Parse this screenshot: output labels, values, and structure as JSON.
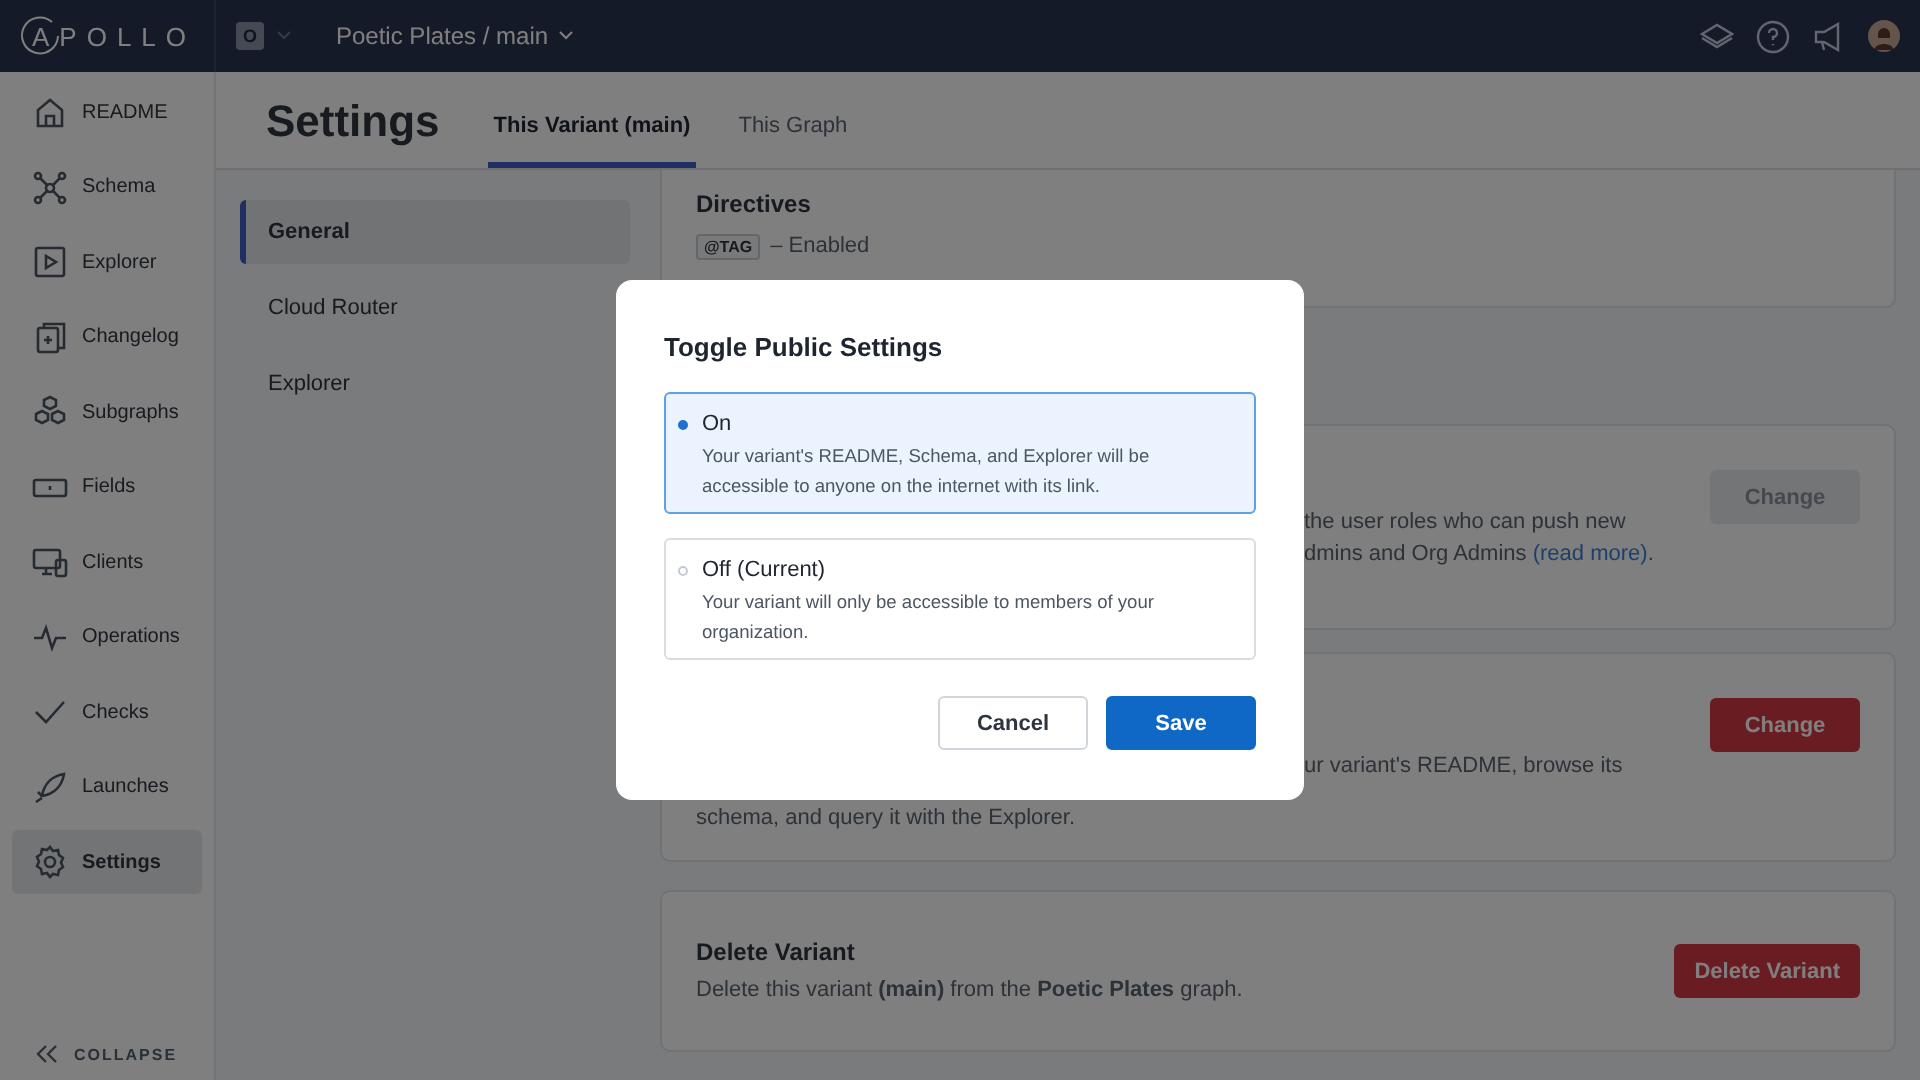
{
  "topbar": {
    "logo": "APOLLO",
    "org_badge": "O",
    "project": "Poetic Plates / main"
  },
  "sidebar": {
    "items": [
      {
        "label": "README",
        "selected": false
      },
      {
        "label": "Schema",
        "selected": false
      },
      {
        "label": "Explorer",
        "selected": false
      },
      {
        "label": "Changelog",
        "selected": false
      },
      {
        "label": "Subgraphs",
        "selected": false
      },
      {
        "label": "Fields",
        "selected": false
      },
      {
        "label": "Clients",
        "selected": false
      },
      {
        "label": "Operations",
        "selected": false
      },
      {
        "label": "Checks",
        "selected": false
      },
      {
        "label": "Launches",
        "selected": false
      },
      {
        "label": "Settings",
        "selected": true
      }
    ],
    "collapse": "COLLAPSE"
  },
  "header": {
    "title": "Settings",
    "tabs": [
      {
        "label": "This Variant (main)",
        "selected": true
      },
      {
        "label": "This Graph",
        "selected": false
      }
    ]
  },
  "subnav": [
    {
      "label": "General",
      "selected": true
    },
    {
      "label": "Cloud Router",
      "selected": false
    },
    {
      "label": "Explorer",
      "selected": false
    }
  ],
  "cards": [
    {
      "kind": "directives",
      "title": "Directives",
      "tag": "@TAG",
      "status": "– Enabled"
    },
    {
      "kind": "setting",
      "lines": [
        {
          "text": "the user roles who can push new",
          "covered_start": true
        },
        {
          "text": "dmins and Org Admins ",
          "link": "(read more)",
          "after": ".",
          "covered_start": true
        }
      ],
      "button": {
        "label": "Change",
        "disabled": true
      }
    },
    {
      "kind": "setting",
      "lines": [
        {
          "text": "ur variant's README, browse its",
          "covered_start": true
        },
        {
          "text": "schema, and query it with the Explorer.",
          "covered_start": false
        }
      ],
      "button": {
        "label": "Change",
        "disabled": false
      }
    },
    {
      "kind": "setting",
      "title": "Delete Variant",
      "lines": [
        {
          "text": "Delete this variant **(main)** from the **Poetic Plates** graph.",
          "covered_start": false
        }
      ],
      "button": {
        "label": "Delete Variant",
        "disabled": false
      }
    }
  ],
  "dialog": {
    "title": "Toggle Public Settings",
    "options": [
      {
        "label": "On",
        "description": "Your variant's README, Schema, and Explorer will be accessible to anyone on the internet with its link.",
        "selected": true
      },
      {
        "label": "Off (Current)",
        "description": "Your variant will only be accessible to members of your organization.",
        "selected": false
      }
    ],
    "buttons": [
      {
        "label": "Cancel",
        "kind": "secondary"
      },
      {
        "label": "Save",
        "kind": "primary"
      }
    ]
  }
}
